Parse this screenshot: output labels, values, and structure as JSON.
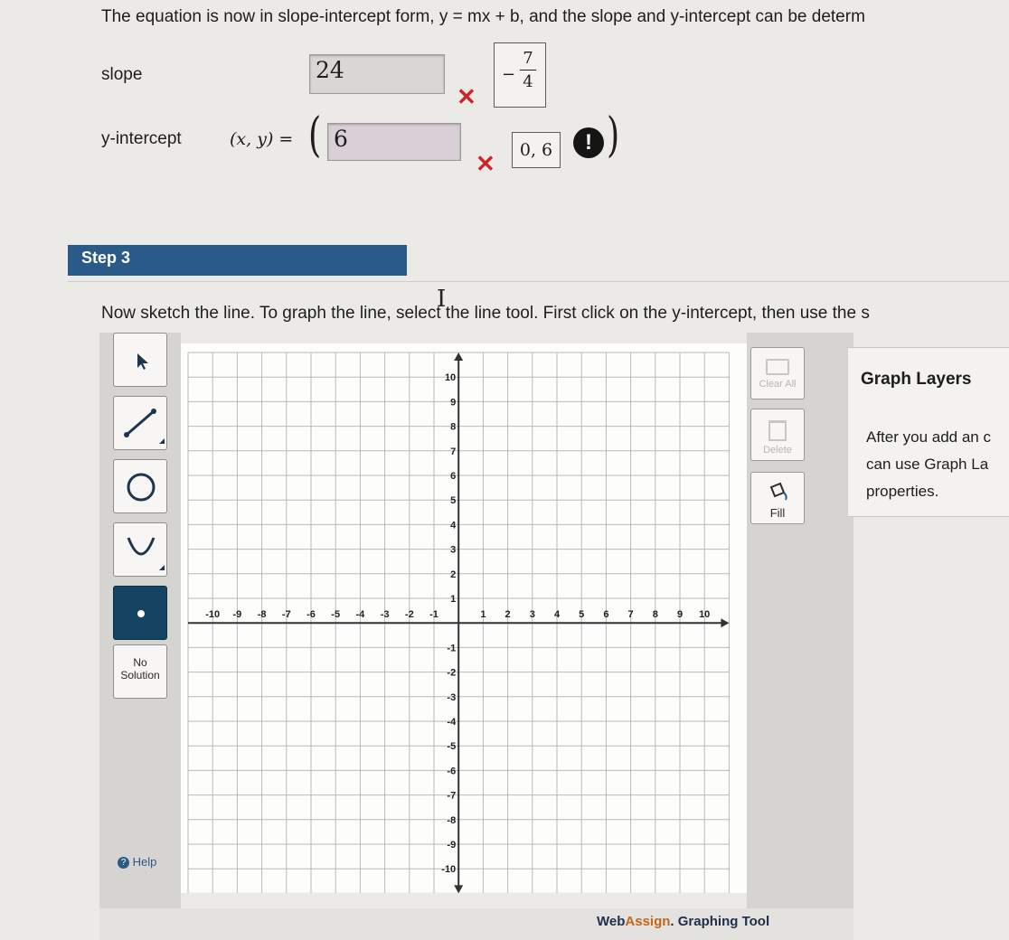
{
  "intro_text": "The equation is now in slope-intercept form, y = mx + b, and the slope and y-intercept can be determ",
  "slope": {
    "label": "slope",
    "answer": "24",
    "wrong_mark": "✕",
    "hint_sign": "−",
    "hint_numerator": "7",
    "hint_denominator": "4"
  },
  "yint": {
    "label": "y-intercept",
    "coord_label": "(x, y) =",
    "open_paren": "(",
    "close_paren": ")",
    "answer": "6",
    "wrong_mark": "✕",
    "hint": "0, 6",
    "alert": "!"
  },
  "step": {
    "label": "Step 3",
    "instruction": "Now sketch the line. To graph the line, select the line tool. First click on the y-intercept, then use the s"
  },
  "tools": {
    "no_solution": [
      "No",
      "Solution"
    ],
    "help": "Help",
    "clear_all": "Clear All",
    "delete": "Delete",
    "fill": "Fill"
  },
  "layers": {
    "title": "Graph Layers",
    "body": [
      "After you add an c",
      "can use Graph La",
      "properties."
    ]
  },
  "graph": {
    "x_ticks": [
      "-10",
      "-9",
      "-8",
      "-7",
      "-6",
      "-5",
      "-4",
      "-3",
      "-2",
      "-1",
      "1",
      "2",
      "3",
      "4",
      "5",
      "6",
      "7",
      "8",
      "9",
      "10"
    ],
    "y_ticks": [
      "10",
      "9",
      "8",
      "7",
      "6",
      "5",
      "4",
      "3",
      "2",
      "1",
      "-1",
      "-2",
      "-3",
      "-4",
      "-5",
      "-6",
      "-7",
      "-8",
      "-9",
      "-10"
    ]
  },
  "footer": {
    "brand_a": "Web",
    "brand_b": "Assign",
    "brand_c": ". Graphing Tool"
  },
  "colors": {
    "accent_blue": "#2a5a88",
    "wrong_red": "#d2232a",
    "active_tool": "#154463"
  }
}
